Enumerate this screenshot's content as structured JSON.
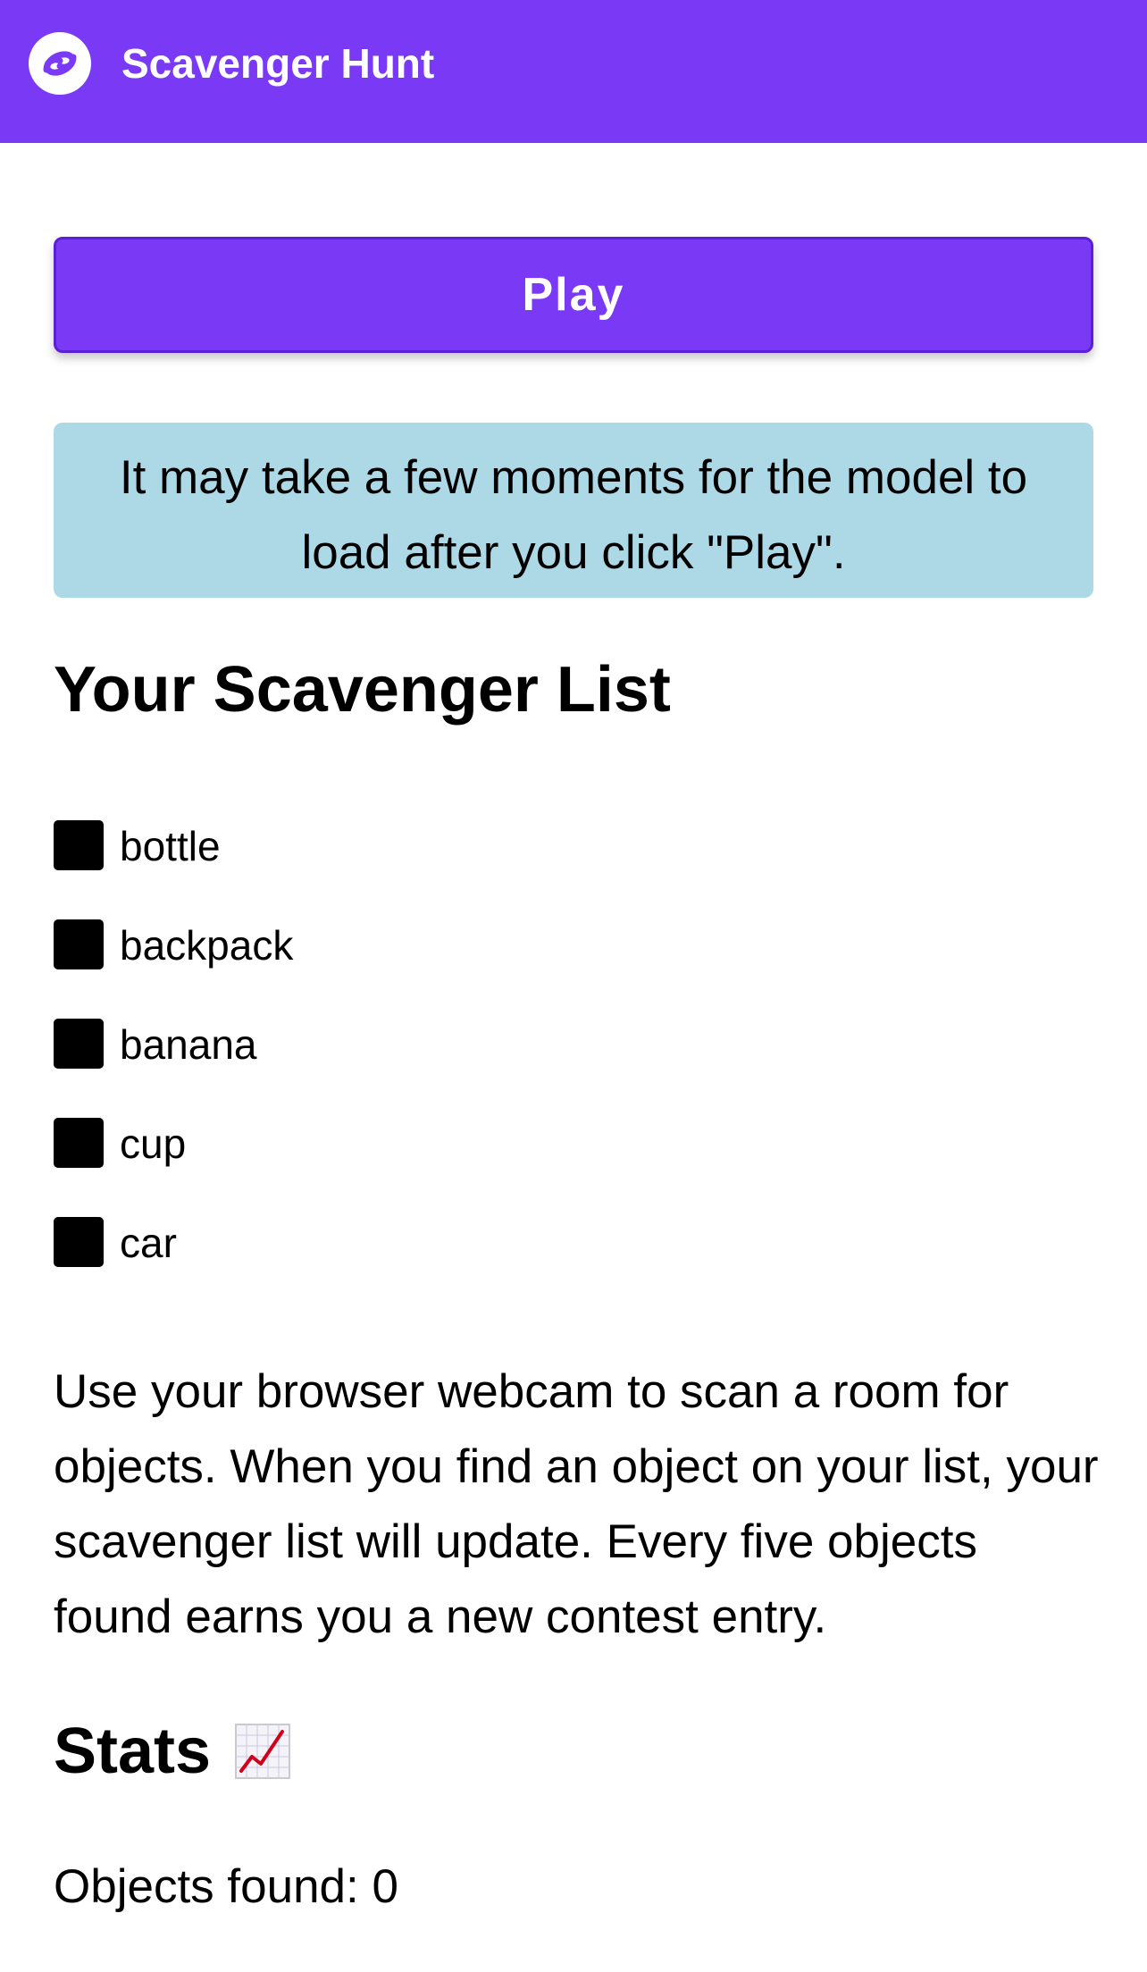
{
  "header": {
    "title": "Scavenger Hunt",
    "background_color": "#7a3af5",
    "logo_icon": "roboflow-logo-icon"
  },
  "play_button": {
    "label": "Play",
    "color": "#7a3af5"
  },
  "info_box": {
    "text": "It may take a few moments for the model to load after you click \"Play\".",
    "background_color": "#add8e6"
  },
  "scavenger_list": {
    "title": "Your Scavenger List",
    "checkbox_icon": "white-square-button-icon",
    "items": [
      {
        "label": "bottle"
      },
      {
        "label": "backpack"
      },
      {
        "label": "banana"
      },
      {
        "label": "cup"
      },
      {
        "label": "car"
      }
    ]
  },
  "description": "Use your browser webcam to scan a room for objects. When you find an object on your list, your scavenger list will update. Every five objects found earns you a new contest entry.",
  "stats": {
    "title": "Stats",
    "title_icon": "chart-increasing-icon",
    "objects_found": "Objects found: 0"
  }
}
